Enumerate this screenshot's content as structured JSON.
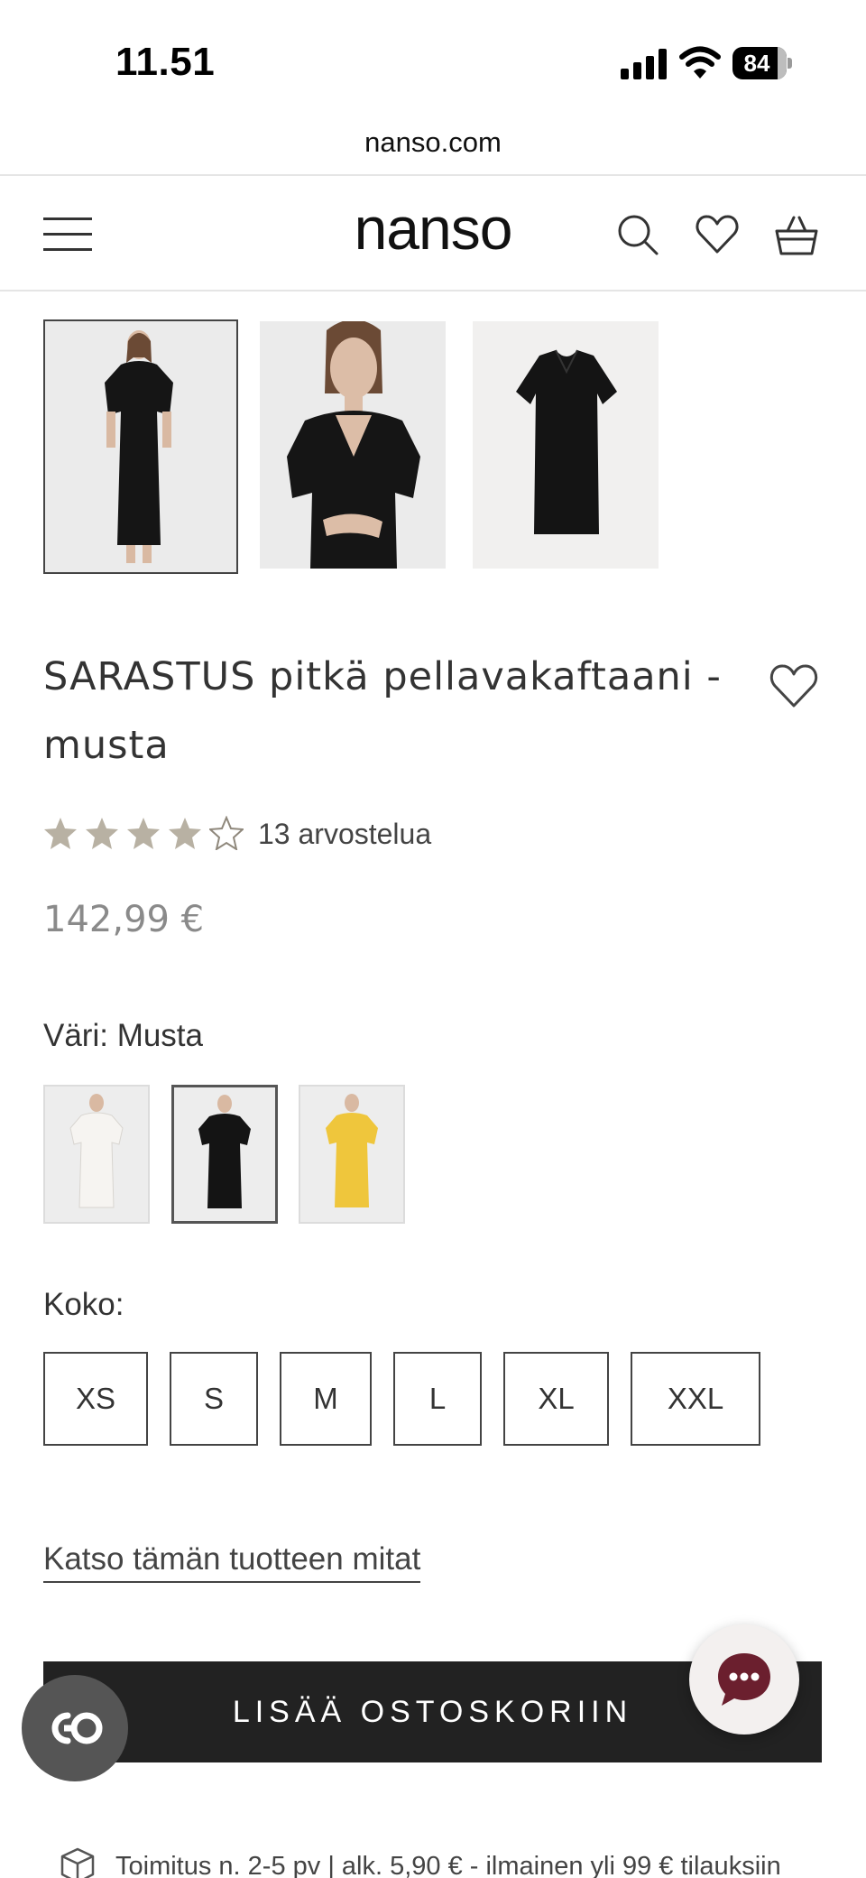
{
  "status_bar": {
    "time": "11.51",
    "battery": "84"
  },
  "browser": {
    "url": "nanso.com"
  },
  "header": {
    "logo": "nanso",
    "icons": [
      "menu-icon",
      "search-icon",
      "heart-icon",
      "basket-icon"
    ]
  },
  "product": {
    "title": "SARASTUS pitkä pellavakaftaani - musta",
    "rating": {
      "value": 4,
      "max": 5,
      "count_label": "13 arvostelua"
    },
    "price": "142,99 €",
    "gallery_images": 3,
    "color_label": "Väri: Musta",
    "colors": [
      {
        "name": "white",
        "hex": "#f4f2ef"
      },
      {
        "name": "black",
        "hex": "#111111",
        "selected": true
      },
      {
        "name": "yellow",
        "hex": "#efc63c"
      }
    ],
    "size_label": "Koko:",
    "sizes": [
      "XS",
      "S",
      "M",
      "L",
      "XL",
      "XXL"
    ],
    "size_guide_link": "Katso tämän tuotteen mitat",
    "add_to_cart": "LISÄÄ OSTOSKORIIN",
    "delivery": "Toimitus n. 2-5 pv | alk. 5,90 € - ilmainen yli 99 € tilauksiin"
  },
  "colors": {
    "accent_dark": "#222222",
    "star": "#b8b1a3",
    "chat": "#6b1f2e"
  }
}
